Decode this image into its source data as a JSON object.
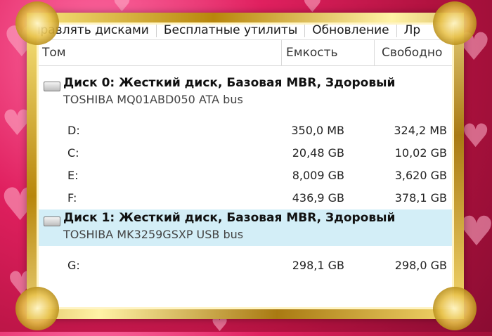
{
  "menu": {
    "items": [
      "Управлять дисками",
      "Бесплатные утилиты",
      "Обновление",
      "Лр"
    ]
  },
  "columns": {
    "volume": "Том",
    "capacity": "Емкость",
    "free": "Свободно"
  },
  "disks": [
    {
      "title": "Диск 0: Жесткий диск, Базовая MBR, Здоровый",
      "model": "TOSHIBA MQ01ABD050 ATA bus",
      "selected": false,
      "partitions": [
        {
          "name": "D:",
          "capacity": "350,0 MB",
          "free": "324,2 MB"
        },
        {
          "name": "C:",
          "capacity": "20,48 GB",
          "free": "10,02 GB"
        },
        {
          "name": "E:",
          "capacity": "8,009 GB",
          "free": "3,620 GB"
        },
        {
          "name": "F:",
          "capacity": "436,9 GB",
          "free": "378,1 GB"
        }
      ]
    },
    {
      "title": "Диск 1: Жесткий диск, Базовая MBR, Здоровый",
      "model": "TOSHIBA MK3259GSXP USB bus",
      "selected": true,
      "partitions": [
        {
          "name": "G:",
          "capacity": "298,1 GB",
          "free": "298,0 GB"
        }
      ]
    }
  ],
  "colors": {
    "selected_row": "#d3eef7",
    "frame_gold": "#d8b233",
    "background_pink": "#e0205f"
  }
}
